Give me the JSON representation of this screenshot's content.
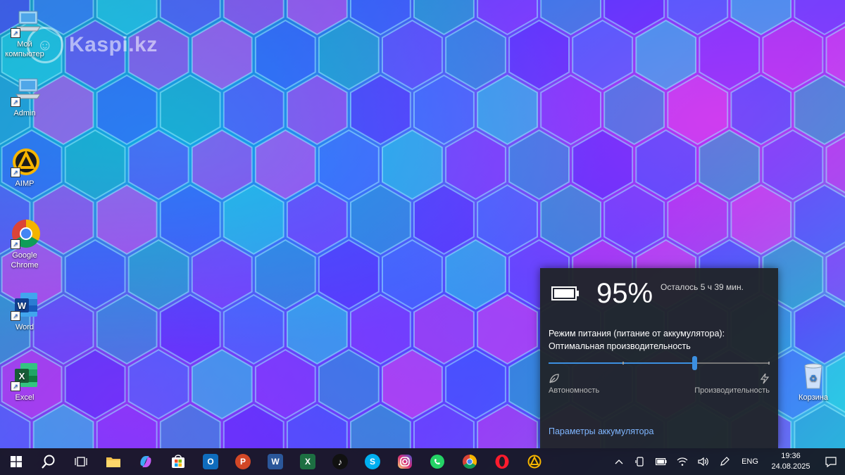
{
  "watermark": {
    "text": "Kaspi.kz"
  },
  "desktop_icons": [
    {
      "label": "Мой компьютер",
      "icon": "computer-icon"
    },
    {
      "label": "Admin",
      "icon": "computer-icon"
    },
    {
      "label": "AIMP",
      "icon": "aimp-icon"
    },
    {
      "label": "Google Chrome",
      "icon": "chrome-icon"
    },
    {
      "label": "Word",
      "icon": "word-icon"
    },
    {
      "label": "Excel",
      "icon": "excel-icon"
    },
    {
      "label": "Корзина",
      "icon": "recycle-bin-icon"
    }
  ],
  "battery_panel": {
    "percent": "95%",
    "remaining": "Осталось 5 ч 39 мин.",
    "mode_title": "Режим питания (питание от аккумулятора):",
    "mode_value": "Оптимальная производительность",
    "slider_level": 0.66,
    "label_left": "Автономность",
    "label_right": "Производительность",
    "settings_link": "Параметры аккумулятора",
    "accent": "#3c8fe0"
  },
  "taskbar": {
    "apps": [
      {
        "name": "file-explorer",
        "icon": "folder-icon",
        "color": "#f2c14e"
      },
      {
        "name": "copilot",
        "icon": "copilot-icon",
        "color": "#8a5cf6"
      },
      {
        "name": "microsoft-store",
        "icon": "store-icon",
        "color": "#ffffff"
      },
      {
        "name": "outlook",
        "icon": "outlook-icon",
        "color": "#0f6cbd"
      },
      {
        "name": "powerpoint",
        "icon": "powerpoint-icon",
        "color": "#d24726"
      },
      {
        "name": "word",
        "icon": "word-icon",
        "color": "#2b579a"
      },
      {
        "name": "excel",
        "icon": "excel-icon",
        "color": "#1d6f42"
      },
      {
        "name": "tiktok",
        "icon": "tiktok-icon",
        "color": "#111111"
      },
      {
        "name": "skype",
        "icon": "skype-icon",
        "color": "#00aff0"
      },
      {
        "name": "instagram",
        "icon": "instagram-icon",
        "color": "#e1306c"
      },
      {
        "name": "whatsapp",
        "icon": "whatsapp-icon",
        "color": "#25d366"
      },
      {
        "name": "chrome",
        "icon": "chrome-icon",
        "color": "#4285f4"
      },
      {
        "name": "opera",
        "icon": "opera-icon",
        "color": "#ff1b2d"
      },
      {
        "name": "aimp",
        "icon": "aimp-icon",
        "color": "#f7b500"
      }
    ],
    "tray": {
      "language": "ENG",
      "time": "19:36",
      "date": "24.08.2025"
    }
  }
}
